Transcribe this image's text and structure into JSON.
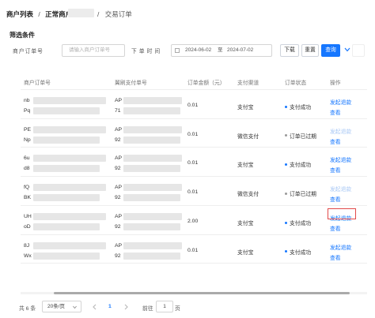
{
  "breadcrumb": {
    "item1": "商户列表",
    "separator1": "/",
    "item2": "正常商户",
    "separator2": "/",
    "item3": "交易订单"
  },
  "filters": {
    "section_title": "筛选条件",
    "merchant_order_label": "商户订单号",
    "merchant_order_placeholder": "请输入商户订单号",
    "order_time_label": "下单时间",
    "date_start": "2024-06-02",
    "date_to": "至",
    "date_end": "2024-07-02",
    "download_label": "下载",
    "reset_label": "重置",
    "query_label": "查询",
    "collapse_icon": "chevron-down-icon"
  },
  "table": {
    "headers": [
      "商户订单号",
      "翼刷支付单号",
      "订单金额（元）",
      "支付渠道",
      "订单状态",
      "操作"
    ],
    "rows": [
      {
        "merchant_order_line1": "nb",
        "merchant_order_line2": "Pq",
        "pay_order_line1": "AP",
        "pay_order_line2": "71",
        "amount": "0.01",
        "channel": "支付宝",
        "status": "支付成功",
        "status_color": "#1677ff",
        "action_refund": "发起退款",
        "action_refund_disabled": false,
        "action_view": "查看"
      },
      {
        "merchant_order_line1": "PE",
        "merchant_order_line2": "Np",
        "pay_order_line1": "AP",
        "pay_order_line2": "92",
        "amount": "0.01",
        "channel": "微信支付",
        "status": "订单已过期",
        "status_color": "#999999",
        "action_refund": "发起退款",
        "action_refund_disabled": true,
        "action_view": "查看"
      },
      {
        "merchant_order_line1": "6u",
        "merchant_order_line2": "d8",
        "pay_order_line1": "AP",
        "pay_order_line2": "92",
        "amount": "0.01",
        "channel": "支付宝",
        "status": "支付成功",
        "status_color": "#1677ff",
        "action_refund": "发起退款",
        "action_refund_disabled": false,
        "action_view": "查看"
      },
      {
        "merchant_order_line1": "fQ",
        "merchant_order_line2": "BK",
        "pay_order_line1": "AP",
        "pay_order_line2": "92",
        "amount": "0.01",
        "channel": "微信支付",
        "status": "订单已过期",
        "status_color": "#999999",
        "action_refund": "发起退款",
        "action_refund_disabled": true,
        "action_view": "查看"
      },
      {
        "merchant_order_line1": "UH",
        "merchant_order_line2": "oD",
        "pay_order_line1": "AP",
        "pay_order_line2": "92",
        "amount": "2.00",
        "channel": "支付宝",
        "status": "支付成功",
        "status_color": "#1677ff",
        "action_refund": "发起退款",
        "action_refund_disabled": false,
        "action_view": "查看",
        "highlighted": true
      },
      {
        "merchant_order_line1": "8J",
        "merchant_order_line2": "Wx",
        "pay_order_line1": "AP",
        "pay_order_line2": "92",
        "amount": "0.01",
        "channel": "支付宝",
        "status": "支付成功",
        "status_color": "#1677ff",
        "action_refund": "发起退款",
        "action_refund_disabled": false,
        "action_view": "查看"
      }
    ]
  },
  "pagination": {
    "total_text": "共 6 条",
    "page_size": "20条/页",
    "prev_icon": "chevron-left-icon",
    "current_page": "1",
    "next_icon": "chevron-right-icon",
    "goto_label": "前往",
    "goto_value": "1",
    "page_suffix": "页"
  },
  "colors": {
    "accent": "#1677ff",
    "highlight_border": "#e24a4a"
  }
}
